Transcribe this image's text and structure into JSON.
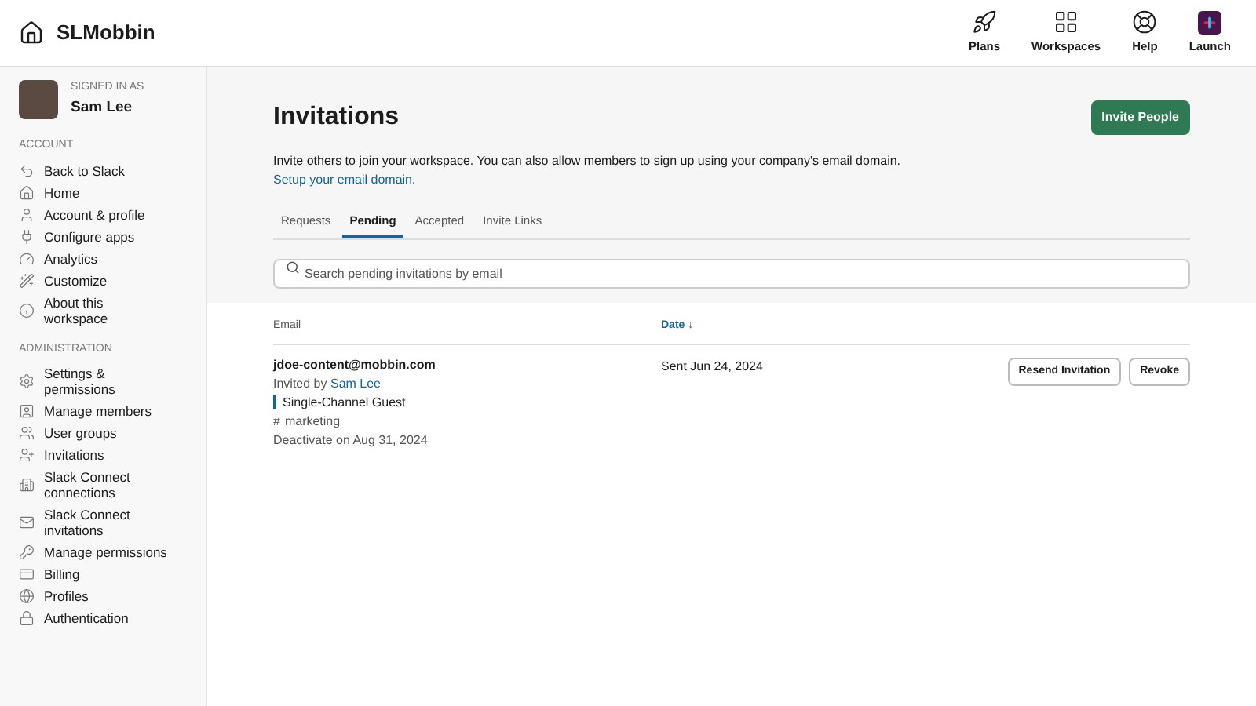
{
  "header": {
    "workspace": "SLMobbin",
    "actions": [
      {
        "kind": "rocket",
        "label": "Plans"
      },
      {
        "kind": "grid",
        "label": "Workspaces"
      },
      {
        "kind": "help",
        "label": "Help"
      },
      {
        "kind": "launch",
        "label": "Launch"
      }
    ]
  },
  "sidebar": {
    "signed_in_label": "SIGNED IN AS",
    "user": "Sam Lee",
    "sections": [
      {
        "title": "ACCOUNT",
        "items": [
          {
            "kind": "back",
            "label": "Back to Slack",
            "selected": false
          },
          {
            "kind": "home",
            "label": "Home",
            "selected": false
          },
          {
            "kind": "user",
            "label": "Account & profile",
            "selected": false
          },
          {
            "kind": "plug",
            "label": "Configure apps",
            "selected": false
          },
          {
            "kind": "gauge",
            "label": "Analytics",
            "selected": false
          },
          {
            "kind": "wand",
            "label": "Customize",
            "selected": false
          },
          {
            "kind": "info",
            "label": "About this workspace",
            "selected": false
          }
        ]
      },
      {
        "title": "ADMINISTRATION",
        "items": [
          {
            "kind": "gear",
            "label": "Settings & permissions",
            "selected": false
          },
          {
            "kind": "badge",
            "label": "Manage members",
            "selected": false
          },
          {
            "kind": "users",
            "label": "User groups",
            "selected": false
          },
          {
            "kind": "userplus",
            "label": "Invitations",
            "selected": false
          },
          {
            "kind": "building",
            "label": "Slack Connect connections",
            "selected": false
          },
          {
            "kind": "mail",
            "label": "Slack Connect invitations",
            "selected": false
          },
          {
            "kind": "key",
            "label": "Manage permissions",
            "selected": false
          },
          {
            "kind": "card",
            "label": "Billing",
            "selected": false
          },
          {
            "kind": "globe",
            "label": "Profiles",
            "selected": false
          },
          {
            "kind": "lock",
            "label": "Authentication",
            "selected": false
          }
        ]
      }
    ]
  },
  "page": {
    "title": "Invitations",
    "primary_button": "Invite People",
    "description": "Invite others to join your workspace. You can also allow members to sign up using your company's email domain.",
    "link": "Setup your email domain",
    "link_suffix": ".",
    "tabs": [
      {
        "label": "Requests",
        "selected": false
      },
      {
        "label": "Pending",
        "selected": true
      },
      {
        "label": "Accepted",
        "selected": false
      },
      {
        "label": "Invite Links",
        "selected": false
      }
    ],
    "search": {
      "placeholder": "Search pending invitations by email"
    }
  },
  "table": {
    "columns": [
      {
        "label": "Email",
        "sorted": false
      },
      {
        "label": "Date ↓",
        "sorted": true
      }
    ],
    "rows": [
      {
        "email": "jdoe-content@mobbin.com",
        "invited_by_label": "Invited by",
        "invited_by": "Sam Lee",
        "role": "Single-Channel Guest",
        "channel_mark": "#",
        "channel": "marketing",
        "deactivate": "Deactivate on Aug 31, 2024",
        "date": "Sent Jun 24, 2024",
        "actions": [
          "Resend Invitation",
          "Revoke"
        ]
      }
    ]
  }
}
